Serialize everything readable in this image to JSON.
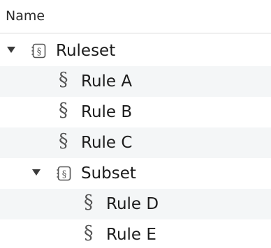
{
  "header": {
    "name_label": "Name"
  },
  "tree": {
    "ruleset": {
      "label": "Ruleset",
      "icon": "ruleset-icon",
      "expanded": true,
      "rules": [
        {
          "label": "Rule A",
          "icon": "section-icon"
        },
        {
          "label": "Rule B",
          "icon": "section-icon"
        },
        {
          "label": "Rule C",
          "icon": "section-icon"
        }
      ],
      "subset": {
        "label": "Subset",
        "icon": "ruleset-icon",
        "expanded": true,
        "rules": [
          {
            "label": "Rule D",
            "icon": "section-icon"
          },
          {
            "label": "Rule E",
            "icon": "section-icon"
          }
        ]
      }
    }
  },
  "colors": {
    "alt_row": "#f4f6f7",
    "text": "#1c1c1c",
    "icon": "#555555"
  }
}
